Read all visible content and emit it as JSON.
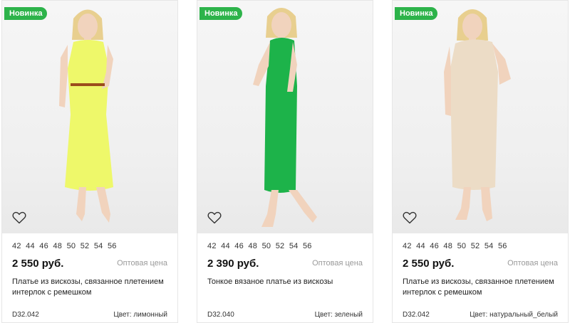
{
  "products": [
    {
      "badge": "Новинка",
      "sizes": [
        "42",
        "44",
        "46",
        "48",
        "50",
        "52",
        "54",
        "56"
      ],
      "price": "2 550 руб.",
      "wholesale_label": "Оптовая цена",
      "description": "Платье из вискозы, связанное плетением интерлок с ремешком",
      "sku": "D32.042",
      "color_label": "Цвет: лимонный",
      "dress_color": "#eef86a",
      "icons": {
        "heart": "heart-outline-icon"
      }
    },
    {
      "badge": "Новинка",
      "sizes": [
        "42",
        "44",
        "46",
        "48",
        "50",
        "52",
        "54",
        "56"
      ],
      "price": "2 390 руб.",
      "wholesale_label": "Оптовая цена",
      "description": "Тонкое вязаное платье из вискозы",
      "sku": "D32.040",
      "color_label": "Цвет: зеленый",
      "dress_color": "#1db34a",
      "icons": {
        "heart": "heart-outline-icon"
      }
    },
    {
      "badge": "Новинка",
      "sizes": [
        "42",
        "44",
        "46",
        "48",
        "50",
        "52",
        "54",
        "56"
      ],
      "price": "2 550 руб.",
      "wholesale_label": "Оптовая цена",
      "description": "Платье из вискозы, связанное плетением интерлок с ремешком",
      "sku": "D32.042",
      "color_label": "Цвет: натуральный_белый",
      "dress_color": "#ecdcc6",
      "icons": {
        "heart": "heart-outline-icon"
      }
    }
  ],
  "colors": {
    "badge": "#2db34a",
    "muted": "#9a9a9a"
  }
}
